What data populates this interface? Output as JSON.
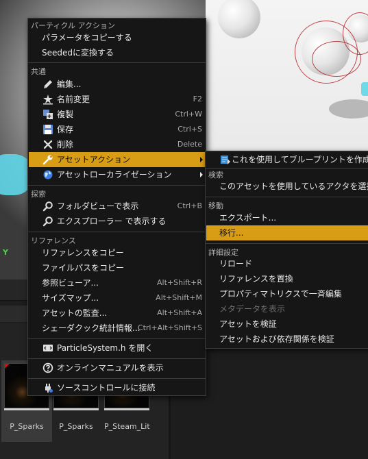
{
  "viewport": {
    "axis_label": "Y"
  },
  "thumbnails": [
    {
      "name": "P_Sparks"
    },
    {
      "name": "P_Sparks"
    },
    {
      "name": "P_Steam_Lit"
    }
  ],
  "main_menu": {
    "sections": {
      "particle": "パーティクル アクション",
      "common": "共通",
      "explore": "探索",
      "reference": "リファレンス"
    },
    "items": {
      "copy_params": "パラメータをコピーする",
      "convert_seeded": "Seededに変換する",
      "edit": "編集...",
      "rename": "名前変更",
      "rename_shortcut": "F2",
      "duplicate": "複製",
      "duplicate_shortcut": "Ctrl+W",
      "save": "保存",
      "save_shortcut": "Ctrl+S",
      "delete": "削除",
      "delete_shortcut": "Delete",
      "asset_actions": "アセットアクション",
      "asset_localization": "アセットローカライゼーション",
      "show_in_folder_view": "フォルダビューで表示",
      "show_in_folder_view_shortcut": "Ctrl+B",
      "show_in_explorer": "エクスプローラー で表示する",
      "copy_reference": "リファレンスをコピー",
      "copy_file_path": "ファイルパスをコピー",
      "reference_viewer": "参照ビューア...",
      "reference_viewer_shortcut": "Alt+Shift+R",
      "size_map": "サイズマップ...",
      "size_map_shortcut": "Alt+Shift+M",
      "asset_audit": "アセットの監査...",
      "asset_audit_shortcut": "Alt+Shift+A",
      "shader_stats": "シェーダクック統計情報...",
      "shader_stats_shortcut": "Ctrl+Alt+Shift+S",
      "open_header": "ParticleSystem.h を開く",
      "online_manual": "オンラインマニュアルを表示",
      "source_control": "ソースコントロールに接続"
    }
  },
  "sub_menu": {
    "sections": {
      "search": "検索",
      "move": "移動",
      "details": "詳細設定"
    },
    "items": {
      "create_blueprint": "これを使用してブループリントを作成...",
      "select_actors": "このアセットを使用しているアクタを選択",
      "export": "エクスポート...",
      "migrate": "移行...",
      "reload": "リロード",
      "replace_references": "リファレンスを置換",
      "bulk_edit": "プロパティマトリクスで一斉編集",
      "show_metadata": "メタデータを表示",
      "validate_asset": "アセットを検証",
      "validate_dependencies": "アセットおよび依存関係を検証"
    }
  },
  "colors": {
    "highlight": "#d89c15",
    "menu_bg": "#161616"
  }
}
